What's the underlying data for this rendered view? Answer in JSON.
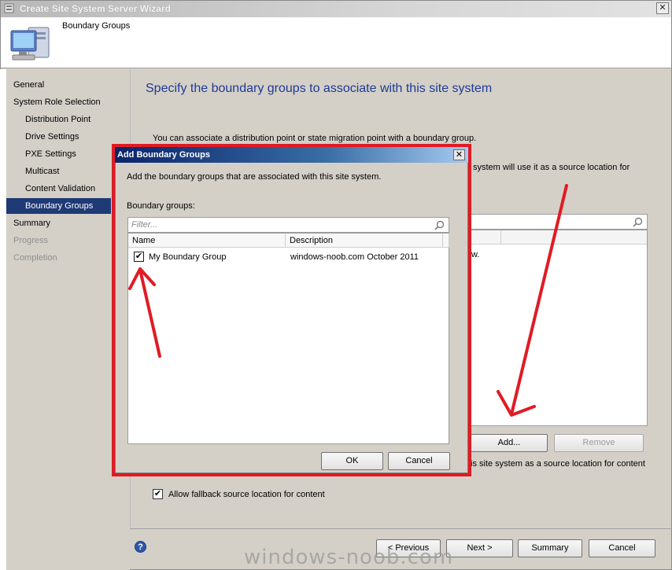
{
  "window": {
    "title": "Create Site System Server Wizard",
    "close_glyph": "✕",
    "header_label": "Boundary Groups"
  },
  "nav": {
    "items": [
      {
        "label": "General",
        "level": "top",
        "state": "normal"
      },
      {
        "label": "System Role Selection",
        "level": "top",
        "state": "normal"
      },
      {
        "label": "Distribution Point",
        "level": "sub",
        "state": "normal"
      },
      {
        "label": "Drive Settings",
        "level": "sub",
        "state": "normal"
      },
      {
        "label": "PXE Settings",
        "level": "sub",
        "state": "normal"
      },
      {
        "label": "Multicast",
        "level": "sub",
        "state": "normal"
      },
      {
        "label": "Content Validation",
        "level": "sub",
        "state": "normal"
      },
      {
        "label": "Boundary Groups",
        "level": "sub",
        "state": "selected"
      },
      {
        "label": "Summary",
        "level": "top",
        "state": "normal"
      },
      {
        "label": "Progress",
        "level": "top",
        "state": "disabled"
      },
      {
        "label": "Completion",
        "level": "top",
        "state": "disabled"
      }
    ]
  },
  "main": {
    "page_title": "Specify the boundary groups to associate with this site system",
    "intro": "You can associate a distribution point or state migration point with a boundary group.",
    "intro_partial": "system will use it as a source location for",
    "list_partial": "w.",
    "add_label": "Add...",
    "remove_label": "Remove",
    "fallback_partial": "is site system as a source location for content",
    "fallback_checkbox_label": "Allow fallback source location for content",
    "fallback_checked": true,
    "check_glyph": "✔",
    "help_glyph": "?"
  },
  "footer": {
    "previous_label": "< Previous",
    "next_label": "Next >",
    "summary_label": "Summary",
    "cancel_label": "Cancel",
    "watermark": "windows-noob.com"
  },
  "dialog": {
    "title": "Add Boundary Groups",
    "close_glyph": "✕",
    "description": "Add the boundary groups that are associated with this site system.",
    "boundary_groups_label": "Boundary groups:",
    "filter_placeholder": "Filter...",
    "columns": {
      "name": "Name",
      "description": "Description"
    },
    "rows": [
      {
        "checked": true,
        "name": "My Boundary Group",
        "description": "windows-noob.com October 2011"
      }
    ],
    "ok_label": "OK",
    "cancel_label": "Cancel"
  },
  "colors": {
    "annotation": "#e01b24",
    "title_blue": "#1f3a94",
    "nav_selected": "#1f3a75"
  }
}
